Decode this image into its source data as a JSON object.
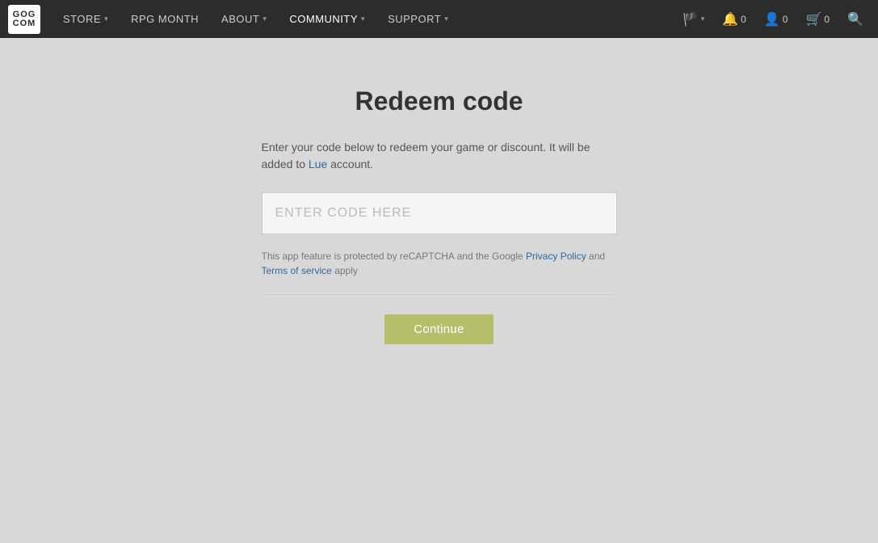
{
  "navbar": {
    "logo_line1": "GOG",
    "logo_line2": "COM",
    "items": [
      {
        "label": "STORE",
        "has_chevron": true
      },
      {
        "label": "RPG MONTH",
        "has_chevron": false
      },
      {
        "label": "ABOUT",
        "has_chevron": true
      },
      {
        "label": "COMMUNITY",
        "has_chevron": true
      },
      {
        "label": "SUPPORT",
        "has_chevron": true
      }
    ],
    "flag_icon": "🏴",
    "notification_count": "0",
    "user_count": "0",
    "cart_count": "0"
  },
  "page": {
    "title": "Redeem code",
    "description_part1": "Enter your code below to redeem your game or discount. It will be added to ",
    "username": "Lue",
    "description_part2": " account.",
    "code_placeholder": "ENTER CODE HERE",
    "recaptcha_text_before": "This app feature is protected by reCAPTCHA and the Google ",
    "recaptcha_privacy": "Privacy Policy",
    "recaptcha_middle": " and ",
    "recaptcha_terms": "Terms of service",
    "recaptcha_after": " apply",
    "continue_label": "Continue"
  }
}
